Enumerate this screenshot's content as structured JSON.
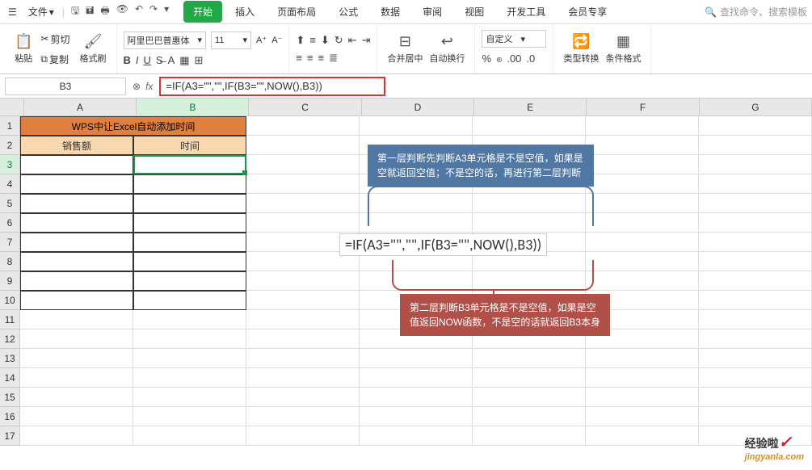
{
  "menu": {
    "file": "文件",
    "tabs": [
      "开始",
      "插入",
      "页面布局",
      "公式",
      "数据",
      "审阅",
      "视图",
      "开发工具",
      "会员专享"
    ],
    "active_tab": 0,
    "search_placeholder": "查找命令、搜索模板"
  },
  "ribbon": {
    "paste": "粘贴",
    "cut": "剪切",
    "copy": "复制",
    "format_painter": "格式刷",
    "font_name": "阿里巴巴普惠体",
    "font_size": "11",
    "merge": "合并居中",
    "wrap": "自动换行",
    "number_format": "自定义",
    "type_convert": "类型转换",
    "cond_format": "条件格式"
  },
  "formula_bar": {
    "name_box": "B3",
    "formula": "=IF(A3=\"\",\"\",IF(B3=\"\",NOW(),B3))"
  },
  "columns": [
    "A",
    "B",
    "C",
    "D",
    "E",
    "F",
    "G"
  ],
  "rows": [
    "1",
    "2",
    "3",
    "4",
    "5",
    "6",
    "7",
    "8",
    "9",
    "10",
    "11",
    "12",
    "13",
    "14",
    "15",
    "16",
    "17"
  ],
  "sheet": {
    "merged_title": "WPS中让Excel自动添加时间",
    "header_a": "销售额",
    "header_b": "时间",
    "active_cell": "B3"
  },
  "annotations": {
    "blue": "第一层判断先判断A3单元格是不是空值，如果是空就返回空值；不是空的话，再进行第二层判断",
    "red": "第二层判断B3单元格是不是空值，如果是空值返回NOW函数，不是空的话就返回B3本身",
    "formula_display": "=IF(A3=\"\",\"\",IF(B3=\"\",NOW(),B3))"
  },
  "watermark": {
    "text": "经验啦",
    "url": "jingyanla.com"
  }
}
